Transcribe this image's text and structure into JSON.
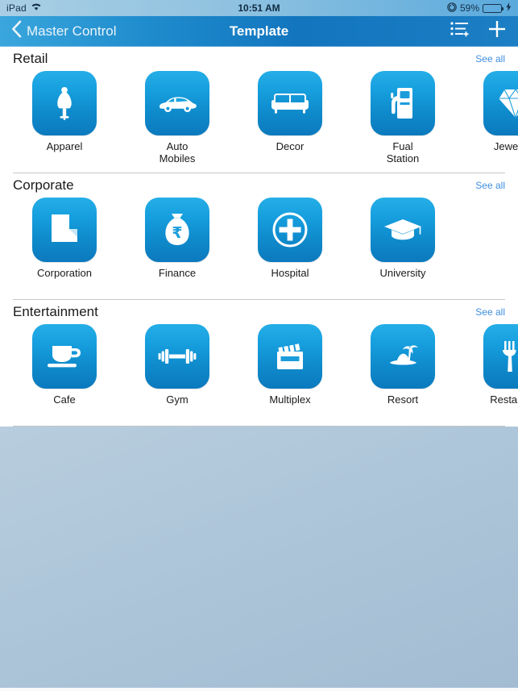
{
  "status_bar": {
    "device": "iPad",
    "wifi_icon": "wifi-icon",
    "time": "10:51 AM",
    "orientation_lock_icon": "rotation-lock-icon",
    "battery_percent": "59%",
    "battery_level": 59,
    "charging_icon": "lightning-bolt-icon",
    "battery_color": "#45d94a"
  },
  "navbar": {
    "back_label": "Master Control",
    "back_icon": "chevron-left-icon",
    "title": "Template",
    "list_add_icon": "list-add-icon",
    "add_icon": "plus-icon",
    "background_color": "#1275be"
  },
  "sections": [
    {
      "title": "Retail",
      "see_all_label": "See all",
      "items": [
        {
          "label": "Apparel",
          "icon": "dress-form-icon"
        },
        {
          "label": "Auto\nMobiles",
          "icon": "car-icon"
        },
        {
          "label": "Decor",
          "icon": "sofa-icon"
        },
        {
          "label": "Fual\nStation",
          "icon": "fuel-pump-icon"
        },
        {
          "label": "Jewellery",
          "icon": "diamond-icon"
        }
      ]
    },
    {
      "title": "Corporate",
      "see_all_label": "See all",
      "items": [
        {
          "label": "Corporation",
          "icon": "office-building-icon"
        },
        {
          "label": "Finance",
          "icon": "money-bag-rupee-icon"
        },
        {
          "label": "Hospital",
          "icon": "medical-cross-circle-icon"
        },
        {
          "label": "University",
          "icon": "graduation-cap-icon"
        }
      ]
    },
    {
      "title": "Entertainment",
      "see_all_label": "See all",
      "items": [
        {
          "label": "Cafe",
          "icon": "coffee-cup-icon"
        },
        {
          "label": "Gym",
          "icon": "dumbbell-icon"
        },
        {
          "label": "Multiplex",
          "icon": "clapperboard-icon"
        },
        {
          "label": "Resort",
          "icon": "island-palm-icon"
        },
        {
          "label": "Restaurant",
          "icon": "fork-knife-icon"
        }
      ]
    }
  ],
  "theme": {
    "tile_gradient_top": "#25aee6",
    "tile_gradient_bottom": "#0b79bd",
    "see_all_color": "#3f8fe0",
    "page_background_top": "#c9dae7",
    "page_background_bottom": "#a3bcd2"
  }
}
